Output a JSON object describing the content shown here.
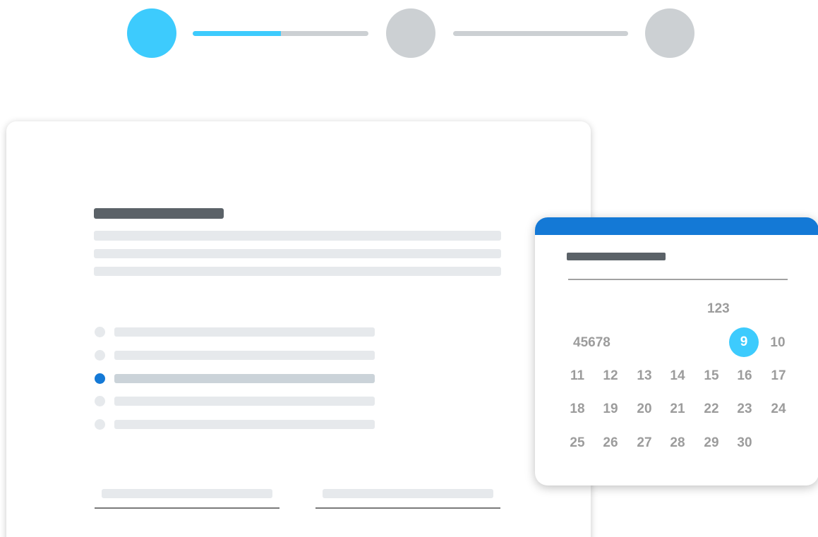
{
  "colors": {
    "accent": "#3dcbfd",
    "primary_blue": "#1479d6",
    "inactive_gray": "#ccd0d3",
    "title_bar": "#5b6268",
    "skeleton_light": "#e6e9ec",
    "skeleton_selected": "#cbd3d9",
    "day_text": "#9c9c9c",
    "divider": "#a2a2a2"
  },
  "stepper": {
    "current_step": 1,
    "total_steps": 3,
    "progress": [
      0.5,
      0
    ]
  },
  "form": {
    "radio_options_count": 5,
    "selected_option_index": 2
  },
  "calendar": {
    "first_row_text": "123",
    "second_row_text": "45678",
    "selected_day": "9",
    "day_10": "10",
    "weeks": [
      [
        "11",
        "12",
        "13",
        "14",
        "15",
        "16",
        "17"
      ],
      [
        "18",
        "19",
        "20",
        "21",
        "22",
        "23",
        "24"
      ],
      [
        "25",
        "26",
        "27",
        "28",
        "29",
        "30"
      ]
    ]
  }
}
